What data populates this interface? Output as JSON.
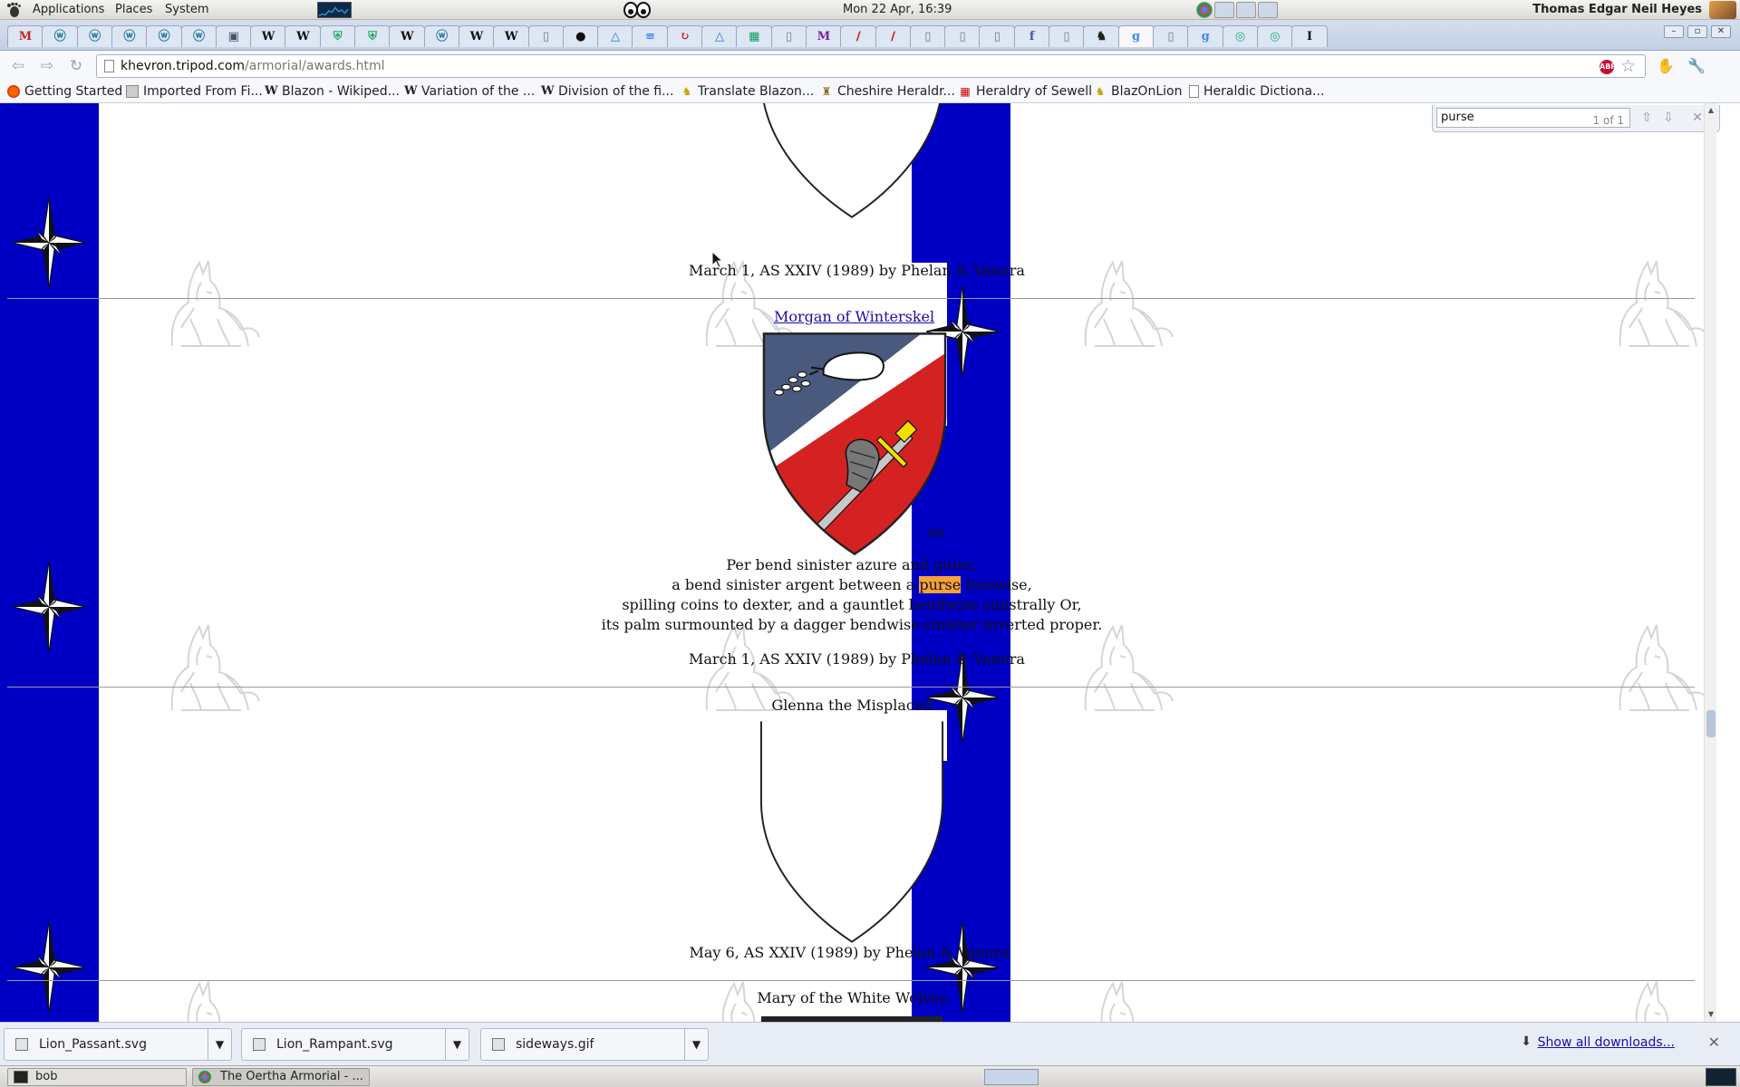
{
  "gnome_panel": {
    "menus": [
      "Applications",
      "Places",
      "System"
    ],
    "clock": "Mon 22 Apr, 16:39",
    "user": "Thomas Edgar Neil Heyes"
  },
  "browser": {
    "url_host": "khevron.tripod.com",
    "url_path": "/armorial/awards.html",
    "abp_label": "ABP",
    "pinned_tabs": [
      "M",
      "W",
      "W",
      "W",
      "W",
      "W",
      "W",
      "W",
      "W",
      "W",
      "W",
      "W",
      "W",
      "W",
      "W",
      "W",
      "W",
      "W",
      "W",
      "W",
      "W",
      "W",
      "W",
      "W",
      "W",
      "W",
      "W",
      "W",
      "W",
      "W",
      "W",
      "W",
      "W",
      "W",
      "W",
      "W",
      "W",
      "W"
    ],
    "tab_icons": [
      "gmail-icon",
      "wordpress-icon",
      "wordpress-icon",
      "wordpress-icon",
      "wordpress-icon",
      "wordpress-icon",
      "image-icon",
      "wikipedia-icon",
      "wikipedia-icon",
      "shield-icon",
      "shield-icon",
      "wikipedia-icon",
      "wordpress-icon",
      "wikipedia-icon",
      "wikipedia-icon",
      "page-icon",
      "github-icon",
      "drive-icon",
      "docs-icon",
      "reload-icon",
      "drive-icon",
      "sheets-icon",
      "page-icon",
      "medium-icon",
      "sword-icon",
      "sword-icon",
      "page-icon",
      "page-icon",
      "page-icon",
      "facebook-icon",
      "page-icon",
      "animal-icon",
      "google-icon",
      "page-icon",
      "google-icon",
      "web-icon",
      "web-icon",
      "instapaper-icon"
    ]
  },
  "bookmarks": [
    {
      "label": "Getting Started",
      "icon": "firefox-icon"
    },
    {
      "label": "Imported From Fi...",
      "icon": "folder-icon"
    },
    {
      "label": "Blazon - Wikiped...",
      "icon": "wikipedia-icon"
    },
    {
      "label": "Variation of the ...",
      "icon": "wikipedia-icon"
    },
    {
      "label": "Division of the fi...",
      "icon": "wikipedia-icon"
    },
    {
      "label": "Translate Blazon...",
      "icon": "lion-icon"
    },
    {
      "label": "Cheshire Heraldr...",
      "icon": "trophy-icon"
    },
    {
      "label": "Heraldry of Sewell",
      "icon": "flag-icon"
    },
    {
      "label": "BlazOnLion",
      "icon": "lion-icon"
    },
    {
      "label": "Heraldic Dictiona...",
      "icon": "page-icon"
    }
  ],
  "findbar": {
    "query": "purse",
    "count": "1 of 1"
  },
  "page": {
    "entry1": {
      "date": "March 1, AS XXIV (1989) by Phelan & Vanora"
    },
    "entry2": {
      "name": "Morgan of Winterskel",
      "artist_mark": "RR",
      "blazon_l1": "Per bend sinister azure and gules,",
      "blazon_l2_pre": "a bend sinister argent between a ",
      "blazon_l2_hl": "purse",
      "blazon_l2_post": " fesswise,",
      "blazon_l3": "spilling coins to dexter, and a gauntlet bendwise sinistrally Or,",
      "blazon_l4": "its palm surmounted by a dagger bendwise sinister inverted proper.",
      "date": "March 1, AS XXIV (1989) by Phelan & Vanora"
    },
    "entry3": {
      "name": "Glenna the Misplaced",
      "date": "May 6, AS XXIV (1989) by Phelan & Vanora"
    },
    "entry4": {
      "name": "Mary of the White Wolves"
    },
    "colors": {
      "band_blue": "#0000c4",
      "shield_azure": "#4a5a7e",
      "shield_gules": "#d42222",
      "highlight": "#f5a13c"
    }
  },
  "downloads": {
    "items": [
      "Lion_Passant.svg",
      "Lion_Rampant.svg",
      "sideways.gif"
    ],
    "show_all": "Show all downloads..."
  },
  "taskbar": {
    "items": [
      "bob",
      "The Oertha Armorial - ..."
    ]
  }
}
